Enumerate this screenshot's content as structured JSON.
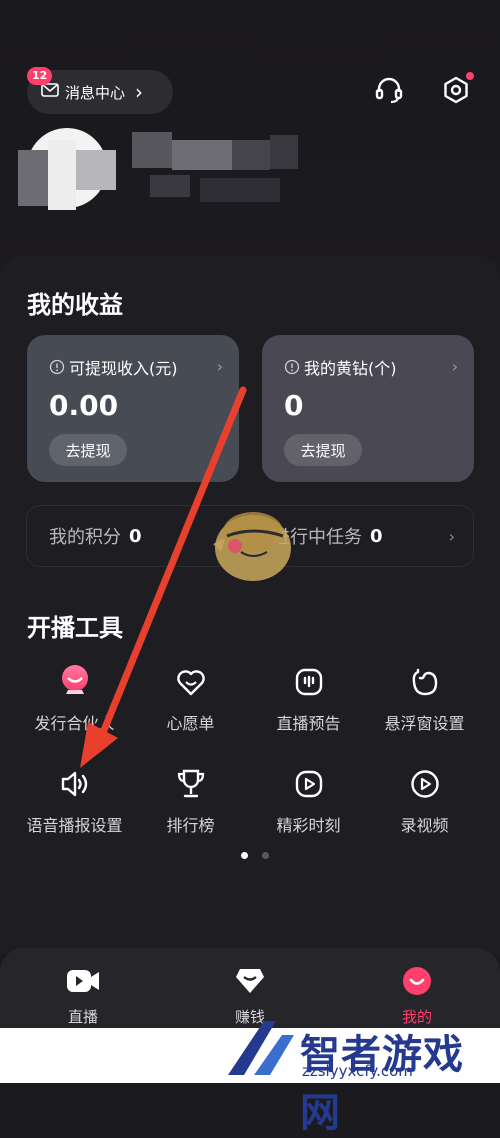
{
  "header": {
    "message_center_label": "消息中心",
    "message_badge": "12",
    "message_chevron": "›"
  },
  "earnings": {
    "title": "我的收益",
    "withdrawable": {
      "label": "可提现收入(元)",
      "value": "0.00",
      "button": "去提现"
    },
    "yellow_diamond": {
      "label": "我的黄钻(个)",
      "value": "0",
      "button": "去提现"
    },
    "points_label": "我的积分",
    "points_value": "0",
    "tasks_label": "进行中任务",
    "tasks_value": "0"
  },
  "tools": {
    "title": "开播工具",
    "items": [
      {
        "label": "发行合伙人",
        "icon": "partner-icon"
      },
      {
        "label": "心愿单",
        "icon": "wishlist-icon"
      },
      {
        "label": "直播预告",
        "icon": "live-preview-icon"
      },
      {
        "label": "悬浮窗设置",
        "icon": "float-window-icon"
      },
      {
        "label": "语音播报设置",
        "icon": "speaker-icon"
      },
      {
        "label": "排行榜",
        "icon": "trophy-icon"
      },
      {
        "label": "精彩时刻",
        "icon": "highlight-play-icon"
      },
      {
        "label": "录视频",
        "icon": "record-video-icon"
      }
    ]
  },
  "pager": {
    "pages": 2,
    "active": 1
  },
  "bottom_nav": {
    "items": [
      {
        "label": "直播",
        "icon": "live-camera-icon"
      },
      {
        "label": "赚钱",
        "icon": "earn-icon"
      },
      {
        "label": "我的",
        "icon": "me-icon",
        "active": true
      }
    ]
  },
  "watermark": {
    "title": "智者游戏网",
    "url": "zzslyyxcfy.com"
  },
  "colors": {
    "accent": "#ff3f6c",
    "card_left": "#464b54",
    "card_right": "#4a4852",
    "arrow": "#e8402d",
    "watermark": "#25398f"
  }
}
